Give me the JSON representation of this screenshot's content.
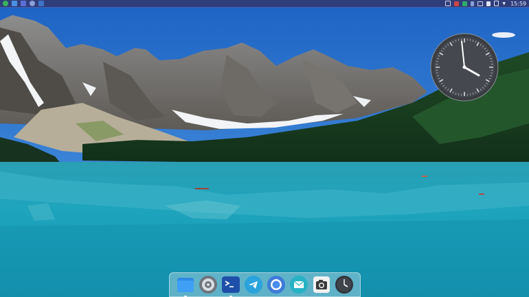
{
  "panel": {
    "clock": "15:59",
    "left_icons": [
      "app-menu-icon",
      "file-manager-icon",
      "browser-icon",
      "settings-icon",
      "task-icon"
    ],
    "tray_icons": [
      "window-icon",
      "clipboard-icon",
      "network-manager-icon",
      "bluetooth-icon",
      "display-icon",
      "volume-icon",
      "battery-icon",
      "menu-down-icon"
    ]
  },
  "dock": {
    "items": [
      {
        "name": "files",
        "icon": "folder-icon",
        "active": true
      },
      {
        "name": "system-settings",
        "icon": "settings-icon",
        "active": false
      },
      {
        "name": "terminal",
        "icon": "terminal-icon",
        "active": true
      },
      {
        "name": "telegram",
        "icon": "telegram-icon",
        "active": false
      },
      {
        "name": "chromium",
        "icon": "chromium-icon",
        "active": false
      },
      {
        "name": "mail",
        "icon": "mail-icon",
        "active": false
      },
      {
        "name": "screenshot",
        "icon": "camera-icon",
        "active": false
      },
      {
        "name": "clock",
        "icon": "clock-icon",
        "active": false
      }
    ]
  },
  "clock_widget": {
    "hours": 3,
    "minutes": 59
  }
}
